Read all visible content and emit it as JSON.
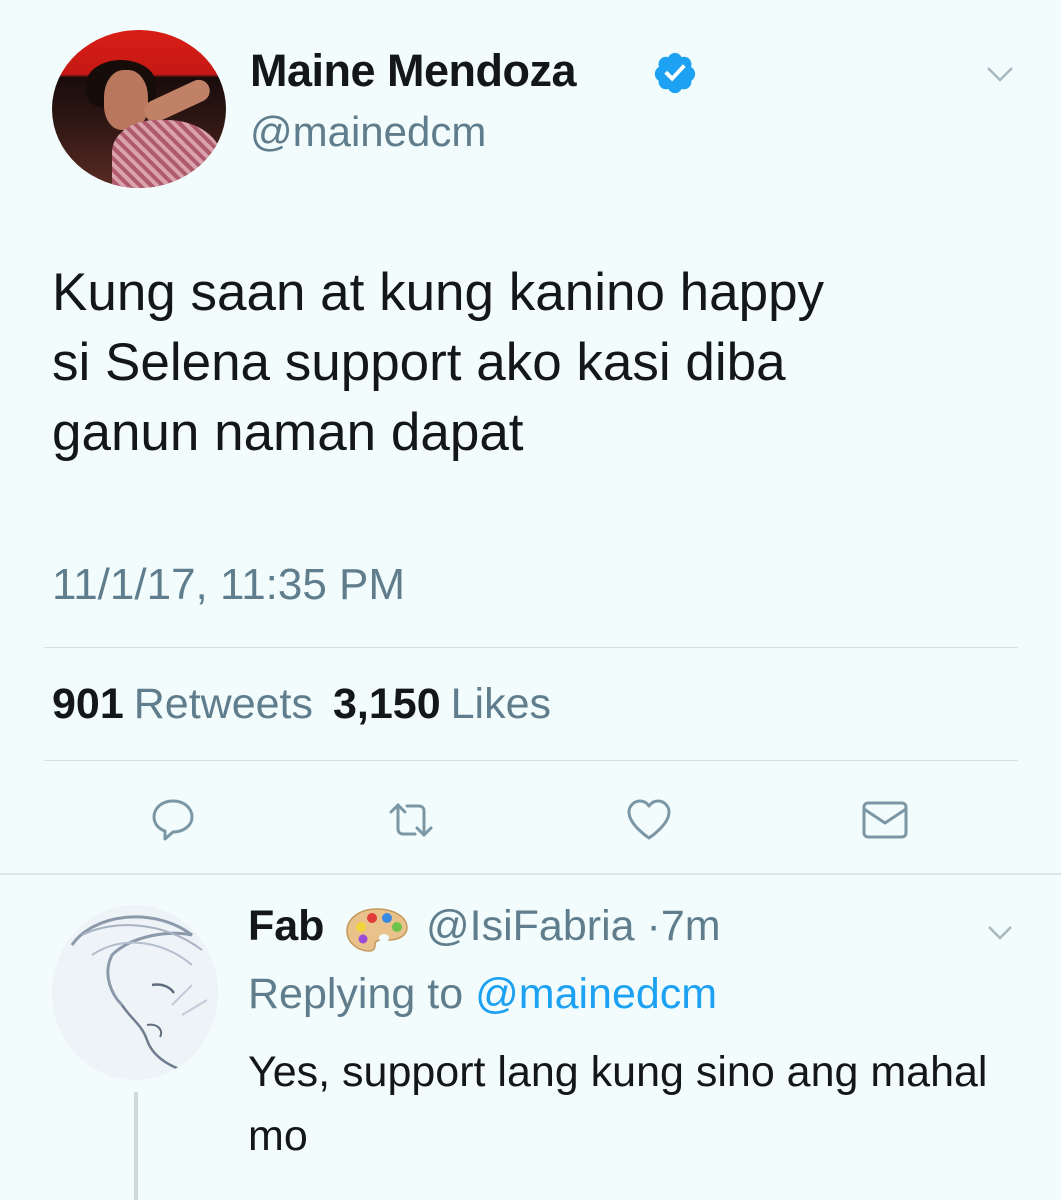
{
  "tweet": {
    "author_name": "Maine Mendoza",
    "author_handle": "@mainedcm",
    "verified": true,
    "text_lines": [
      "Kung saan at kung kanino happy",
      "si Selena support ako kasi diba",
      "ganun naman dapat"
    ],
    "timestamp": "11/1/17, 11:35 PM",
    "retweets_count": "901",
    "retweets_label": "Retweets",
    "likes_count": "3,150",
    "likes_label": "Likes"
  },
  "actions": [
    "reply-icon",
    "retweet-icon",
    "like-icon",
    "message-icon"
  ],
  "reply": {
    "author_name": "Fab",
    "author_emoji_icon": "artist-palette-icon",
    "author_handle": "@IsiFabria",
    "separator": "·",
    "time_ago": "7m",
    "replying_prefix": "Replying to",
    "replying_to": "@mainedcm",
    "text": "Yes, support lang kung sino ang mahal mo"
  },
  "colors": {
    "background": "#f3fcfc",
    "text": "#14171a",
    "secondary": "#5f7d8c",
    "link": "#1da1f2",
    "verified": "#1da1f2"
  }
}
